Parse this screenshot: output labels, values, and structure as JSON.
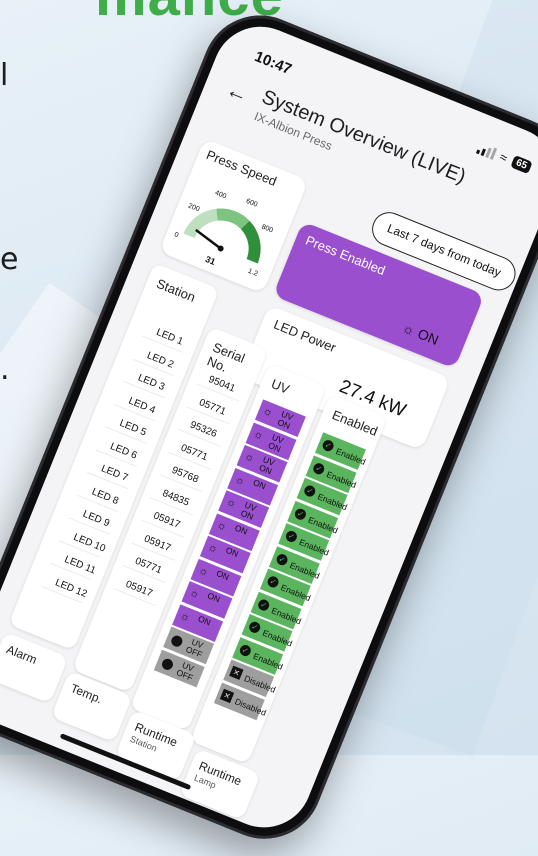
{
  "headline": "mance",
  "side_glyphs": [
    "l",
    "e",
    "."
  ],
  "status": {
    "time": "10:47",
    "battery": "65"
  },
  "appbar": {
    "title": "System Overview (LIVE)",
    "subtitle": "IX-Albion Press"
  },
  "press_speed": {
    "label": "Press Speed",
    "value": 31,
    "value_label": "31",
    "ticks": [
      "0",
      "200",
      "400",
      "600",
      "800",
      "1.2"
    ]
  },
  "range_button": "Last 7 days from today",
  "press_enabled": {
    "label": "Press Enabled",
    "state": "ON"
  },
  "led_power": {
    "label": "LED Power",
    "value": "27.4 kW"
  },
  "table": {
    "headers": {
      "station": "Station",
      "serial": "Serial No.",
      "uv": "UV",
      "enabled": "Enabled"
    },
    "stations": [
      "LED 1",
      "LED 2",
      "LED 3",
      "LED 4",
      "LED 5",
      "LED 6",
      "LED 7",
      "LED 8",
      "LED 9",
      "LED 10",
      "LED 11",
      "LED 12"
    ],
    "serials": [
      "95041",
      "05771",
      "95326",
      "05771",
      "95768",
      "84835",
      "05917",
      "05917",
      "05771",
      "05917"
    ],
    "uv": [
      {
        "l1": "UV",
        "l2": "ON",
        "state": "on"
      },
      {
        "l1": "UV",
        "l2": "ON",
        "state": "on"
      },
      {
        "l1": "UV",
        "l2": "ON",
        "state": "on"
      },
      {
        "l1": "ON",
        "l2": "",
        "state": "on"
      },
      {
        "l1": "UV",
        "l2": "ON",
        "state": "on"
      },
      {
        "l1": "ON",
        "l2": "",
        "state": "on"
      },
      {
        "l1": "ON",
        "l2": "",
        "state": "on"
      },
      {
        "l1": "ON",
        "l2": "",
        "state": "on"
      },
      {
        "l1": "ON",
        "l2": "",
        "state": "on"
      },
      {
        "l1": "ON",
        "l2": "",
        "state": "on"
      },
      {
        "l1": "UV",
        "l2": "OFF",
        "state": "off"
      },
      {
        "l1": "UV",
        "l2": "OFF",
        "state": "off"
      }
    ],
    "enabled": [
      "Enabled",
      "Enabled",
      "Enabled",
      "Enabled",
      "Enabled",
      "Enabled",
      "Enabled",
      "Enabled",
      "Enabled",
      "Enabled",
      "Disabled",
      "Disabled"
    ]
  },
  "bottom_cards": [
    {
      "a": "Alarm",
      "b": ""
    },
    {
      "a": "Temp.",
      "b": ""
    },
    {
      "a": "Runtime",
      "b": "Station"
    },
    {
      "a": "Runtime",
      "b": "Lamp"
    }
  ],
  "colors": {
    "purple": "#9a4fcf",
    "green": "#5bb55e",
    "grey": "#9e9e9e",
    "headline_green": "#3fae49"
  }
}
